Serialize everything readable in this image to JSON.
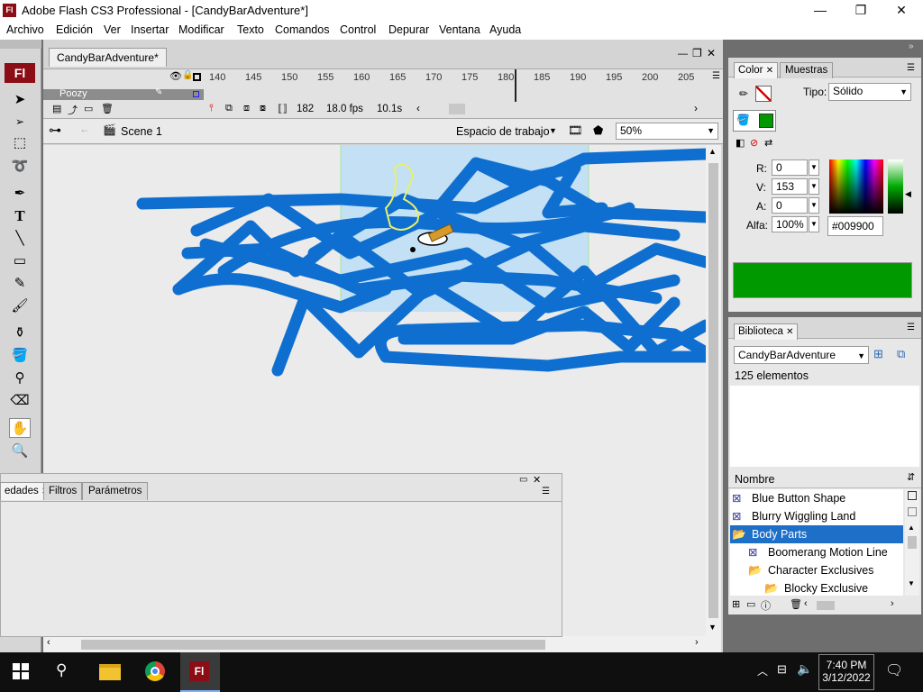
{
  "window": {
    "title": "Adobe Flash CS3 Professional - [CandyBarAdventure*]",
    "app_icon": "Fl",
    "minimize": "—",
    "maximize": "❐",
    "close": "✕"
  },
  "menu": [
    "Archivo",
    "Edición",
    "Ver",
    "Insertar",
    "Modificar",
    "Texto",
    "Comandos",
    "Control",
    "Depurar",
    "Ventana",
    "Ayuda"
  ],
  "toolbar": {
    "logo": "Fl"
  },
  "document": {
    "tab": "CandyBarAdventure*"
  },
  "timeline": {
    "frame_numbers": [
      "140",
      "145",
      "150",
      "155",
      "160",
      "165",
      "170",
      "175",
      "180",
      "185",
      "190",
      "195",
      "200",
      "205"
    ],
    "layer_name": "Poozy",
    "current_frame": "182",
    "fps": "18.0 fps",
    "time": "10.1s"
  },
  "editbar": {
    "scene": "Scene 1",
    "workspace": "Espacio de trabajo",
    "zoom": "50%"
  },
  "properties": {
    "tabs": [
      "edades",
      "Filtros",
      "Parámetros"
    ]
  },
  "color_panel": {
    "tabs": [
      "Color",
      "Muestras"
    ],
    "type_label": "Tipo:",
    "type_value": "Sólido",
    "r_label": "R:",
    "r_value": "0",
    "g_label": "V:",
    "g_value": "153",
    "b_label": "A:",
    "b_value": "0",
    "alpha_label": "Alfa:",
    "alpha_value": "100%",
    "hex": "#009900",
    "fill_color": "#009900",
    "stroke_color": "#0f6fd0"
  },
  "library": {
    "tab": "Biblioteca",
    "document": "CandyBarAdventure",
    "count": "125 elementos",
    "column": "Nombre",
    "items": [
      {
        "name": "Blue Button Shape",
        "type": "symbol",
        "selected": false
      },
      {
        "name": "Blurry Wiggling Land",
        "type": "symbol",
        "selected": false
      },
      {
        "name": "Body Parts",
        "type": "folder",
        "selected": true
      },
      {
        "name": "Boomerang Motion Line",
        "type": "symbol",
        "selected": false
      },
      {
        "name": "Character Exclusives",
        "type": "folder",
        "selected": false
      },
      {
        "name": "Blocky Exclusive",
        "type": "folder",
        "selected": false
      }
    ]
  },
  "taskbar": {
    "time": "7:40 PM",
    "date": "3/12/2022",
    "pinned_app": "Fl"
  }
}
